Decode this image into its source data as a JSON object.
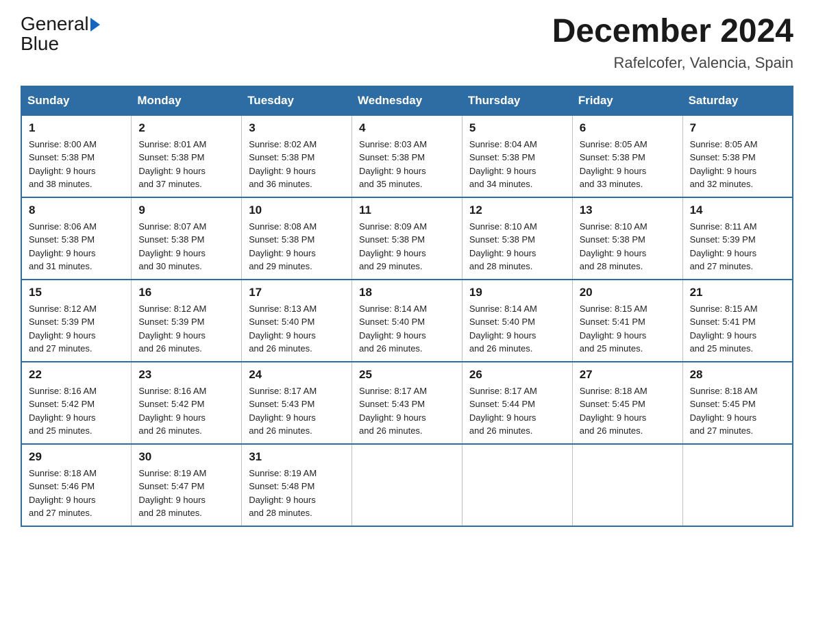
{
  "header": {
    "logo_text_general": "General",
    "logo_text_blue": "Blue",
    "main_title": "December 2024",
    "subtitle": "Rafelcofer, Valencia, Spain"
  },
  "calendar": {
    "headers": [
      "Sunday",
      "Monday",
      "Tuesday",
      "Wednesday",
      "Thursday",
      "Friday",
      "Saturday"
    ],
    "weeks": [
      [
        {
          "day": "1",
          "sunrise": "8:00 AM",
          "sunset": "5:38 PM",
          "daylight": "9 hours and 38 minutes."
        },
        {
          "day": "2",
          "sunrise": "8:01 AM",
          "sunset": "5:38 PM",
          "daylight": "9 hours and 37 minutes."
        },
        {
          "day": "3",
          "sunrise": "8:02 AM",
          "sunset": "5:38 PM",
          "daylight": "9 hours and 36 minutes."
        },
        {
          "day": "4",
          "sunrise": "8:03 AM",
          "sunset": "5:38 PM",
          "daylight": "9 hours and 35 minutes."
        },
        {
          "day": "5",
          "sunrise": "8:04 AM",
          "sunset": "5:38 PM",
          "daylight": "9 hours and 34 minutes."
        },
        {
          "day": "6",
          "sunrise": "8:05 AM",
          "sunset": "5:38 PM",
          "daylight": "9 hours and 33 minutes."
        },
        {
          "day": "7",
          "sunrise": "8:05 AM",
          "sunset": "5:38 PM",
          "daylight": "9 hours and 32 minutes."
        }
      ],
      [
        {
          "day": "8",
          "sunrise": "8:06 AM",
          "sunset": "5:38 PM",
          "daylight": "9 hours and 31 minutes."
        },
        {
          "day": "9",
          "sunrise": "8:07 AM",
          "sunset": "5:38 PM",
          "daylight": "9 hours and 30 minutes."
        },
        {
          "day": "10",
          "sunrise": "8:08 AM",
          "sunset": "5:38 PM",
          "daylight": "9 hours and 29 minutes."
        },
        {
          "day": "11",
          "sunrise": "8:09 AM",
          "sunset": "5:38 PM",
          "daylight": "9 hours and 29 minutes."
        },
        {
          "day": "12",
          "sunrise": "8:10 AM",
          "sunset": "5:38 PM",
          "daylight": "9 hours and 28 minutes."
        },
        {
          "day": "13",
          "sunrise": "8:10 AM",
          "sunset": "5:38 PM",
          "daylight": "9 hours and 28 minutes."
        },
        {
          "day": "14",
          "sunrise": "8:11 AM",
          "sunset": "5:39 PM",
          "daylight": "9 hours and 27 minutes."
        }
      ],
      [
        {
          "day": "15",
          "sunrise": "8:12 AM",
          "sunset": "5:39 PM",
          "daylight": "9 hours and 27 minutes."
        },
        {
          "day": "16",
          "sunrise": "8:12 AM",
          "sunset": "5:39 PM",
          "daylight": "9 hours and 26 minutes."
        },
        {
          "day": "17",
          "sunrise": "8:13 AM",
          "sunset": "5:40 PM",
          "daylight": "9 hours and 26 minutes."
        },
        {
          "day": "18",
          "sunrise": "8:14 AM",
          "sunset": "5:40 PM",
          "daylight": "9 hours and 26 minutes."
        },
        {
          "day": "19",
          "sunrise": "8:14 AM",
          "sunset": "5:40 PM",
          "daylight": "9 hours and 26 minutes."
        },
        {
          "day": "20",
          "sunrise": "8:15 AM",
          "sunset": "5:41 PM",
          "daylight": "9 hours and 25 minutes."
        },
        {
          "day": "21",
          "sunrise": "8:15 AM",
          "sunset": "5:41 PM",
          "daylight": "9 hours and 25 minutes."
        }
      ],
      [
        {
          "day": "22",
          "sunrise": "8:16 AM",
          "sunset": "5:42 PM",
          "daylight": "9 hours and 25 minutes."
        },
        {
          "day": "23",
          "sunrise": "8:16 AM",
          "sunset": "5:42 PM",
          "daylight": "9 hours and 26 minutes."
        },
        {
          "day": "24",
          "sunrise": "8:17 AM",
          "sunset": "5:43 PM",
          "daylight": "9 hours and 26 minutes."
        },
        {
          "day": "25",
          "sunrise": "8:17 AM",
          "sunset": "5:43 PM",
          "daylight": "9 hours and 26 minutes."
        },
        {
          "day": "26",
          "sunrise": "8:17 AM",
          "sunset": "5:44 PM",
          "daylight": "9 hours and 26 minutes."
        },
        {
          "day": "27",
          "sunrise": "8:18 AM",
          "sunset": "5:45 PM",
          "daylight": "9 hours and 26 minutes."
        },
        {
          "day": "28",
          "sunrise": "8:18 AM",
          "sunset": "5:45 PM",
          "daylight": "9 hours and 27 minutes."
        }
      ],
      [
        {
          "day": "29",
          "sunrise": "8:18 AM",
          "sunset": "5:46 PM",
          "daylight": "9 hours and 27 minutes."
        },
        {
          "day": "30",
          "sunrise": "8:19 AM",
          "sunset": "5:47 PM",
          "daylight": "9 hours and 28 minutes."
        },
        {
          "day": "31",
          "sunrise": "8:19 AM",
          "sunset": "5:48 PM",
          "daylight": "9 hours and 28 minutes."
        },
        null,
        null,
        null,
        null
      ]
    ]
  }
}
